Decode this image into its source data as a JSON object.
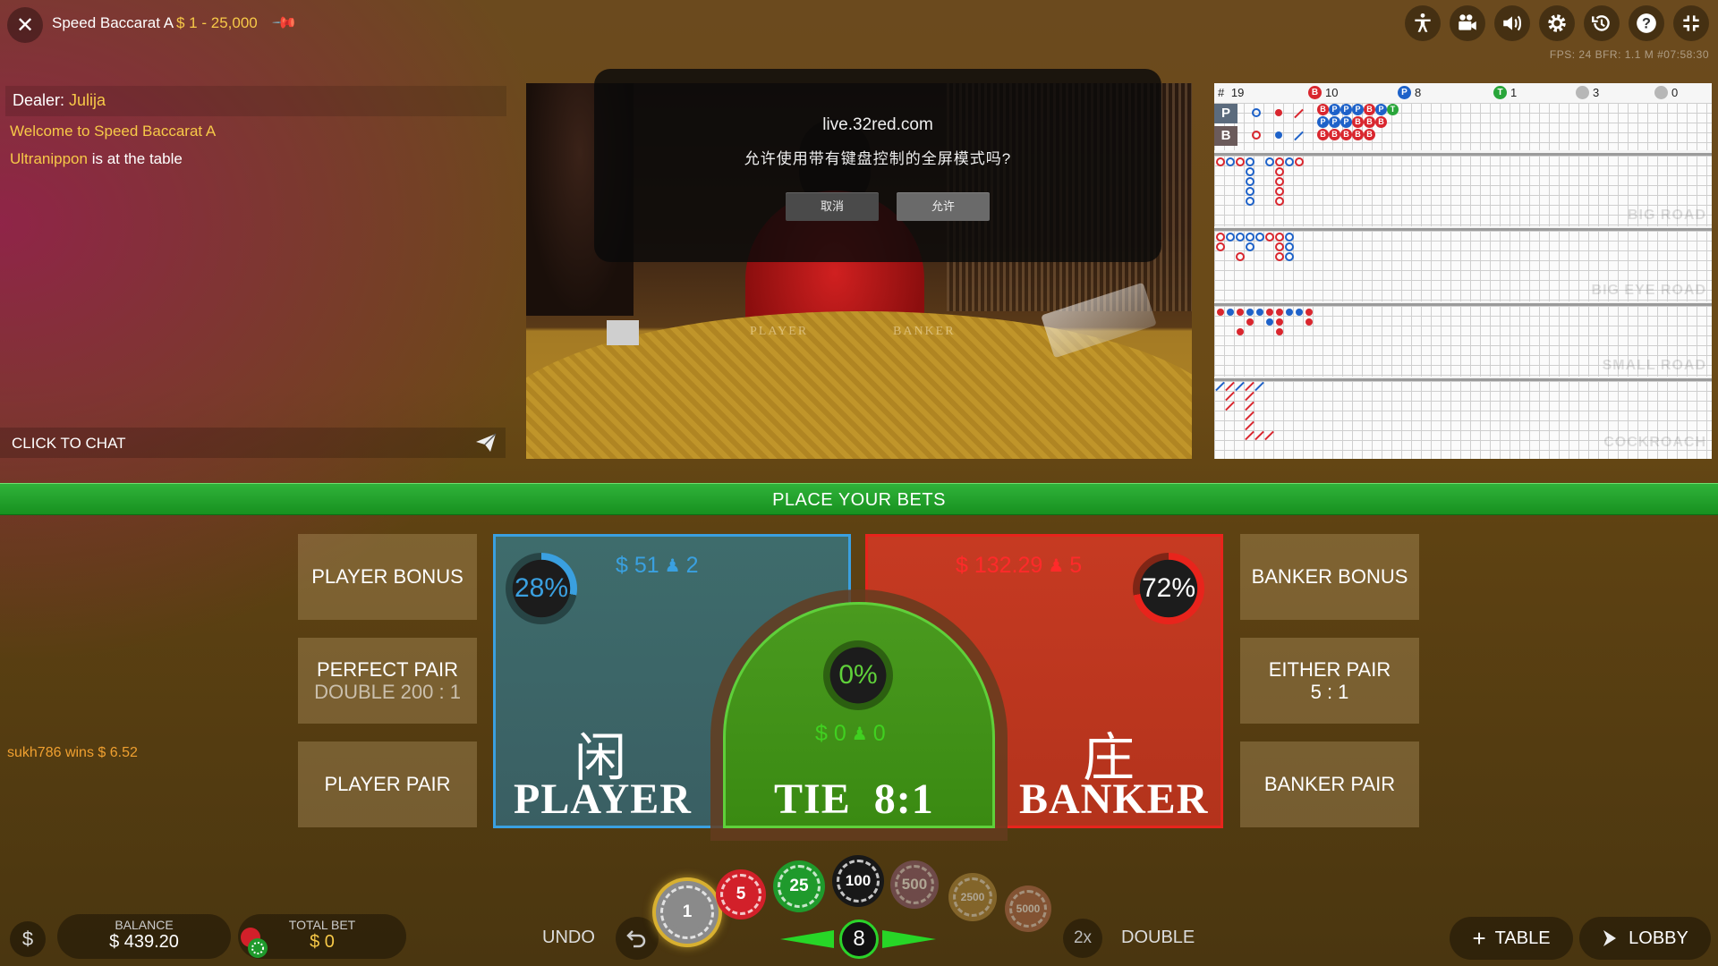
{
  "header": {
    "game_title": "Speed Baccarat A",
    "limits": "$ 1 - 25,000",
    "fps_line": "FPS: 24 BFR: 1.1   M      #07:58:30",
    "icons": [
      "accessibility-icon",
      "video-camera-icon",
      "volume-icon",
      "settings-icon",
      "history-icon",
      "help-icon",
      "exit-fullscreen-icon"
    ]
  },
  "chat": {
    "dealer_label": "Dealer:",
    "dealer_name": "Julija",
    "welcome": "Welcome to Speed Baccarat A",
    "join_user": "Ultranippon",
    "join_text": "is at the table",
    "input_placeholder": "CLICK TO CHAT",
    "winner_msg": "sukh786 wins $ 6.52"
  },
  "video": {
    "felt_player": "PLAYER",
    "felt_banker": "BANKER"
  },
  "dialog": {
    "host": "live.32red.com",
    "question": "允许使用带有键盘控制的全屏模式吗?",
    "cancel": "取消",
    "allow": "允许"
  },
  "roadmap": {
    "hand_no": "19",
    "banker_wins": "10",
    "player_wins": "8",
    "ties": "1",
    "banker_pairs": "3",
    "player_pairs": "0",
    "pred_p": "P",
    "pred_b": "B",
    "bead_letters": {
      "b": "B",
      "p": "P",
      "t": "T"
    },
    "labels": {
      "big_road": "BIG ROAD",
      "big_eye": "BIG EYE ROAD",
      "small": "SMALL ROAD",
      "cockroach": "COCKROACH"
    }
  },
  "status": {
    "text": "PLACE YOUR BETS"
  },
  "bets": {
    "player_bonus": "PLAYER BONUS",
    "perfect_pair": "PERFECT PAIR",
    "perfect_pair_sub": "DOUBLE 200 : 1",
    "player_pair": "PLAYER PAIR",
    "banker_bonus": "BANKER BONUS",
    "either_pair": "EITHER PAIR",
    "either_pair_sub": "5 : 1",
    "banker_pair": "BANKER PAIR",
    "player": {
      "zh": "闲",
      "label": "PLAYER",
      "percent": "28%",
      "percent_value": 28,
      "amount": "$ 51",
      "players": "2"
    },
    "tie": {
      "label": "TIE  8:1",
      "percent": "0%",
      "percent_value": 0,
      "amount": "$ 0",
      "players": "0"
    },
    "banker": {
      "zh": "庄",
      "label": "BANKER",
      "percent": "72%",
      "percent_value": 72,
      "amount": "$ 132.29",
      "players": "5"
    }
  },
  "footer": {
    "balance_label": "BALANCE",
    "balance_value": "$ 439.20",
    "totalbet_label": "TOTAL BET",
    "totalbet_value": "$ 0",
    "undo": "UNDO",
    "double_icon": "2x",
    "double": "DOUBLE",
    "table": "TABLE",
    "lobby": "LOBBY",
    "chip_counter": "8",
    "dollar": "$",
    "chips": [
      {
        "value": "1",
        "color": "#8a8a8a",
        "selected": true
      },
      {
        "value": "5",
        "color": "#d2202a"
      },
      {
        "value": "25",
        "color": "#1f9a2c"
      },
      {
        "value": "100",
        "color": "#181818"
      },
      {
        "value": "500",
        "color": "#8a5a78",
        "dim": true
      },
      {
        "value": "2500",
        "color": "#b08a40",
        "dim": true
      },
      {
        "value": "5000",
        "color": "#b06a50",
        "dim": true
      }
    ]
  },
  "colors": {
    "accent_yellow": "#f7c948",
    "player_blue": "#3aa0e0",
    "banker_red": "#e8241c",
    "tie_green": "#5fd03a"
  }
}
